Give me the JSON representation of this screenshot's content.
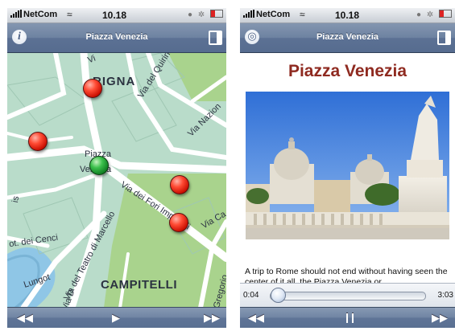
{
  "map_screen": {
    "status": {
      "carrier": "NetCom",
      "time": "10.18"
    },
    "nav": {
      "title": "Piazza Venezia",
      "info_icon": "info-icon",
      "panel_icon": "panel-icon"
    },
    "map_labels": {
      "rigna": "RIGNA",
      "quirinale": "Via del Quirinale",
      "nazionale": "Via Nazion",
      "piazza": "Piazza",
      "venezia": "Venezia",
      "fori": "Via dei Fori Imperiali",
      "marcello": "Via del Teatro di Marcello",
      "cenci": "ot. dei Cenci",
      "lungot": "Lungot",
      "campitelli": "CAMPITELLI",
      "via_d": "Via D",
      "via_ca": "Via Ca",
      "gregorio": "Gregorio",
      "via_top": "Vi",
      "left_edge": "is"
    },
    "pins": [
      {
        "type": "red",
        "x": 41.9,
        "y": 12.9
      },
      {
        "type": "red",
        "x": 12.7,
        "y": 14.1
      },
      {
        "type": "green",
        "x": 12.49,
        "y": 12.36
      },
      {
        "type": "red",
        "x": 12.7,
        "y": 9.95
      },
      {
        "type": "red",
        "x": 12.9,
        "y": 10.3
      }
    ],
    "toolbar": {
      "rewind": "◀◀",
      "play": "▶",
      "forward": "▶▶"
    }
  },
  "detail_screen": {
    "status": {
      "carrier": "NetCom",
      "time": "10.18"
    },
    "nav": {
      "title": "Piazza Venezia",
      "globe_icon": "globe-icon",
      "panel_icon": "panel-icon"
    },
    "title": "Piazza Venezia",
    "description": "A trip to Rome should not end without having seen the center of it all, the Piazza Venezia or",
    "player": {
      "elapsed": "0:04",
      "remaining": "3:03",
      "progress": 0.02
    },
    "toolbar": {
      "rewind": "◀◀",
      "pause": "❙❙",
      "forward": "▶▶"
    }
  },
  "colors": {
    "nav_blue": "#6d82a1",
    "title_red": "#8f2a20",
    "map_green": "#b8dcc9",
    "pin_red": "#e0301f",
    "pin_green": "#2aa53c"
  }
}
